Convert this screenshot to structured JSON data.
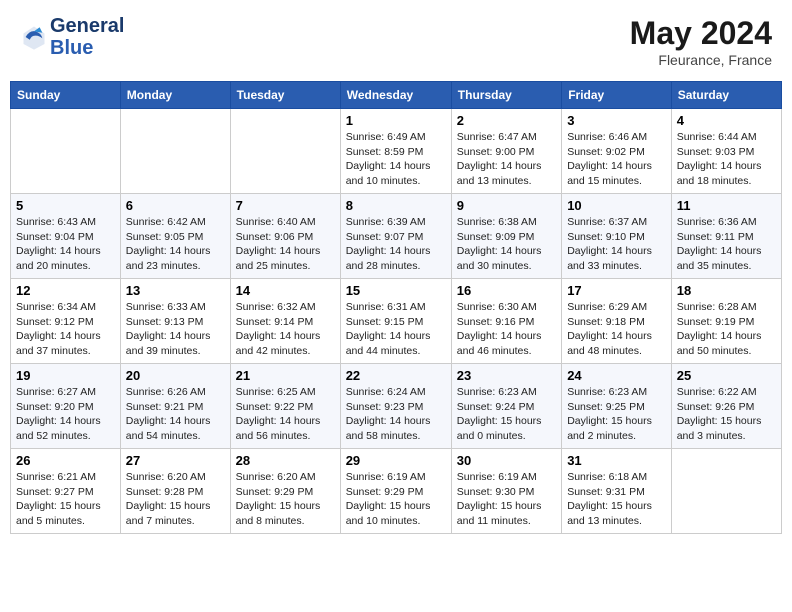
{
  "header": {
    "logo_line1": "General",
    "logo_line2": "Blue",
    "month_title": "May 2024",
    "location": "Fleurance, France"
  },
  "days_of_week": [
    "Sunday",
    "Monday",
    "Tuesday",
    "Wednesday",
    "Thursday",
    "Friday",
    "Saturday"
  ],
  "weeks": [
    [
      {
        "day": "",
        "info": ""
      },
      {
        "day": "",
        "info": ""
      },
      {
        "day": "",
        "info": ""
      },
      {
        "day": "1",
        "info": "Sunrise: 6:49 AM\nSunset: 8:59 PM\nDaylight: 14 hours\nand 10 minutes."
      },
      {
        "day": "2",
        "info": "Sunrise: 6:47 AM\nSunset: 9:00 PM\nDaylight: 14 hours\nand 13 minutes."
      },
      {
        "day": "3",
        "info": "Sunrise: 6:46 AM\nSunset: 9:02 PM\nDaylight: 14 hours\nand 15 minutes."
      },
      {
        "day": "4",
        "info": "Sunrise: 6:44 AM\nSunset: 9:03 PM\nDaylight: 14 hours\nand 18 minutes."
      }
    ],
    [
      {
        "day": "5",
        "info": "Sunrise: 6:43 AM\nSunset: 9:04 PM\nDaylight: 14 hours\nand 20 minutes."
      },
      {
        "day": "6",
        "info": "Sunrise: 6:42 AM\nSunset: 9:05 PM\nDaylight: 14 hours\nand 23 minutes."
      },
      {
        "day": "7",
        "info": "Sunrise: 6:40 AM\nSunset: 9:06 PM\nDaylight: 14 hours\nand 25 minutes."
      },
      {
        "day": "8",
        "info": "Sunrise: 6:39 AM\nSunset: 9:07 PM\nDaylight: 14 hours\nand 28 minutes."
      },
      {
        "day": "9",
        "info": "Sunrise: 6:38 AM\nSunset: 9:09 PM\nDaylight: 14 hours\nand 30 minutes."
      },
      {
        "day": "10",
        "info": "Sunrise: 6:37 AM\nSunset: 9:10 PM\nDaylight: 14 hours\nand 33 minutes."
      },
      {
        "day": "11",
        "info": "Sunrise: 6:36 AM\nSunset: 9:11 PM\nDaylight: 14 hours\nand 35 minutes."
      }
    ],
    [
      {
        "day": "12",
        "info": "Sunrise: 6:34 AM\nSunset: 9:12 PM\nDaylight: 14 hours\nand 37 minutes."
      },
      {
        "day": "13",
        "info": "Sunrise: 6:33 AM\nSunset: 9:13 PM\nDaylight: 14 hours\nand 39 minutes."
      },
      {
        "day": "14",
        "info": "Sunrise: 6:32 AM\nSunset: 9:14 PM\nDaylight: 14 hours\nand 42 minutes."
      },
      {
        "day": "15",
        "info": "Sunrise: 6:31 AM\nSunset: 9:15 PM\nDaylight: 14 hours\nand 44 minutes."
      },
      {
        "day": "16",
        "info": "Sunrise: 6:30 AM\nSunset: 9:16 PM\nDaylight: 14 hours\nand 46 minutes."
      },
      {
        "day": "17",
        "info": "Sunrise: 6:29 AM\nSunset: 9:18 PM\nDaylight: 14 hours\nand 48 minutes."
      },
      {
        "day": "18",
        "info": "Sunrise: 6:28 AM\nSunset: 9:19 PM\nDaylight: 14 hours\nand 50 minutes."
      }
    ],
    [
      {
        "day": "19",
        "info": "Sunrise: 6:27 AM\nSunset: 9:20 PM\nDaylight: 14 hours\nand 52 minutes."
      },
      {
        "day": "20",
        "info": "Sunrise: 6:26 AM\nSunset: 9:21 PM\nDaylight: 14 hours\nand 54 minutes."
      },
      {
        "day": "21",
        "info": "Sunrise: 6:25 AM\nSunset: 9:22 PM\nDaylight: 14 hours\nand 56 minutes."
      },
      {
        "day": "22",
        "info": "Sunrise: 6:24 AM\nSunset: 9:23 PM\nDaylight: 14 hours\nand 58 minutes."
      },
      {
        "day": "23",
        "info": "Sunrise: 6:23 AM\nSunset: 9:24 PM\nDaylight: 15 hours\nand 0 minutes."
      },
      {
        "day": "24",
        "info": "Sunrise: 6:23 AM\nSunset: 9:25 PM\nDaylight: 15 hours\nand 2 minutes."
      },
      {
        "day": "25",
        "info": "Sunrise: 6:22 AM\nSunset: 9:26 PM\nDaylight: 15 hours\nand 3 minutes."
      }
    ],
    [
      {
        "day": "26",
        "info": "Sunrise: 6:21 AM\nSunset: 9:27 PM\nDaylight: 15 hours\nand 5 minutes."
      },
      {
        "day": "27",
        "info": "Sunrise: 6:20 AM\nSunset: 9:28 PM\nDaylight: 15 hours\nand 7 minutes."
      },
      {
        "day": "28",
        "info": "Sunrise: 6:20 AM\nSunset: 9:29 PM\nDaylight: 15 hours\nand 8 minutes."
      },
      {
        "day": "29",
        "info": "Sunrise: 6:19 AM\nSunset: 9:29 PM\nDaylight: 15 hours\nand 10 minutes."
      },
      {
        "day": "30",
        "info": "Sunrise: 6:19 AM\nSunset: 9:30 PM\nDaylight: 15 hours\nand 11 minutes."
      },
      {
        "day": "31",
        "info": "Sunrise: 6:18 AM\nSunset: 9:31 PM\nDaylight: 15 hours\nand 13 minutes."
      },
      {
        "day": "",
        "info": ""
      }
    ]
  ]
}
